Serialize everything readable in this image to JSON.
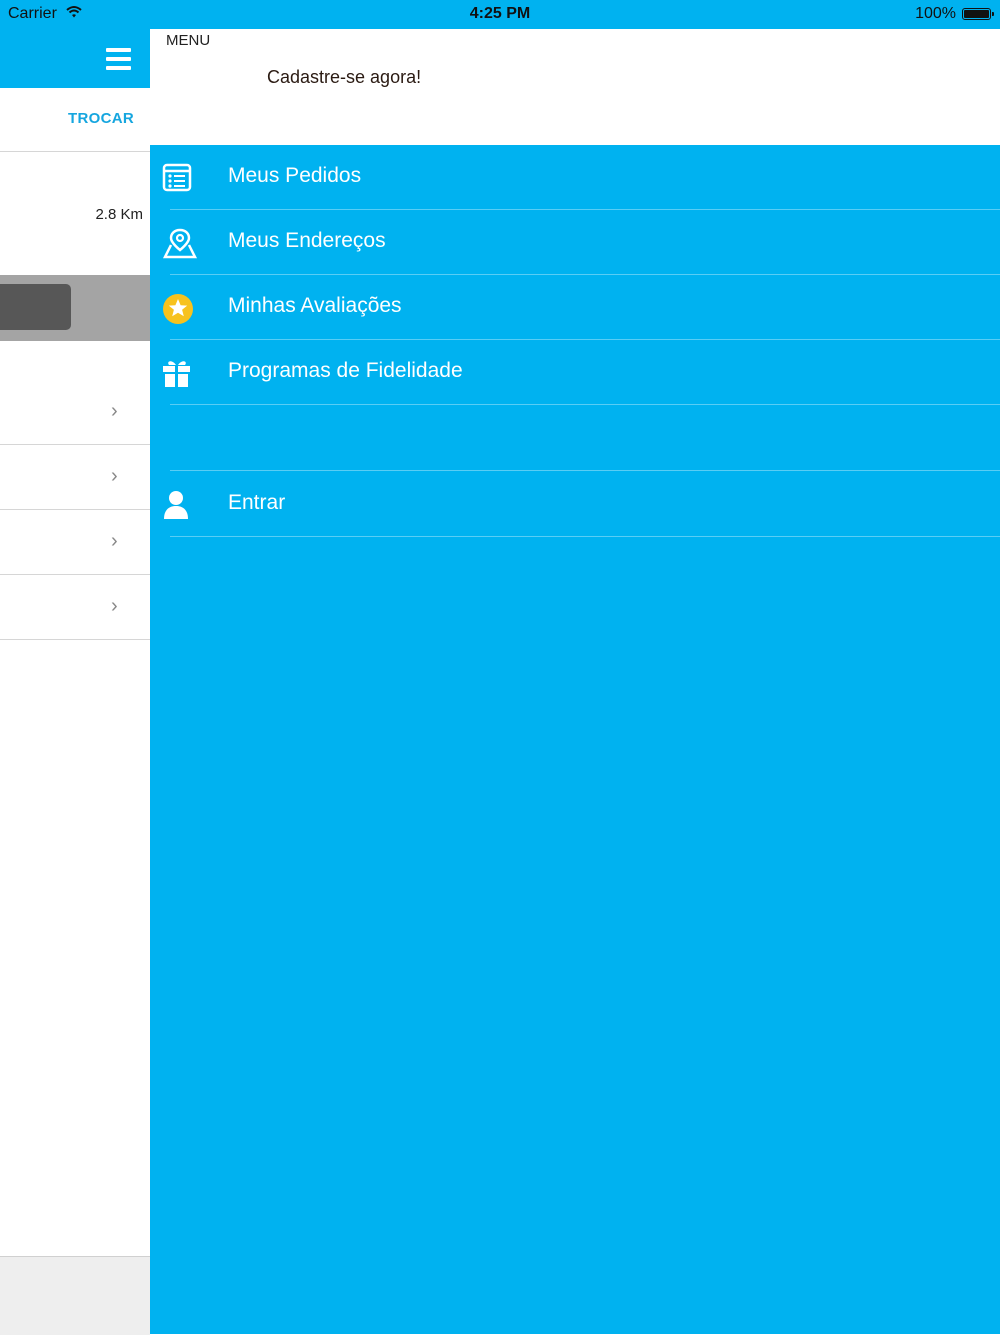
{
  "status_bar": {
    "carrier": "Carrier",
    "time": "4:25 PM",
    "battery": "100%"
  },
  "background": {
    "change_label": "TROCAR",
    "distance": "2.8 Km",
    "chevron": "›"
  },
  "menu": {
    "title": "MENU",
    "signup": "Cadastre-se agora!",
    "items": [
      {
        "label": "Meus Pedidos",
        "icon": "list-icon"
      },
      {
        "label": "Meus Endereços",
        "icon": "map-pin-icon"
      },
      {
        "label": "Minhas Avaliações",
        "icon": "star-icon"
      },
      {
        "label": "Programas de Fidelidade",
        "icon": "gift-icon"
      },
      {
        "label": "Entrar",
        "icon": "user-icon"
      }
    ]
  },
  "colors": {
    "accent": "#00b2f0",
    "star": "#f7c21e"
  }
}
